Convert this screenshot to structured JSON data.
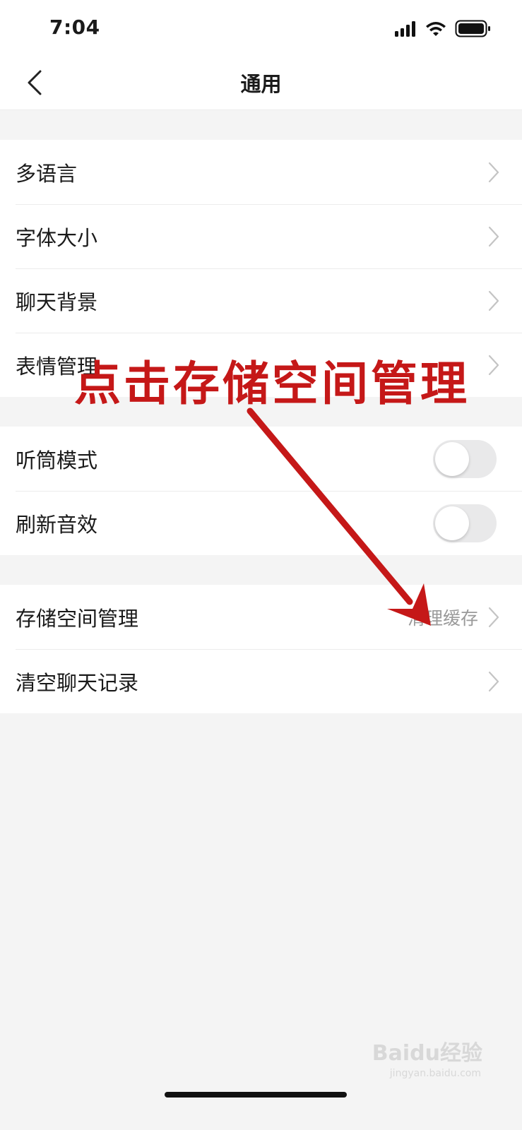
{
  "status_bar": {
    "time": "7:04"
  },
  "nav": {
    "title": "通用"
  },
  "groups": [
    {
      "items": [
        {
          "label": "多语言"
        },
        {
          "label": "字体大小"
        },
        {
          "label": "聊天背景"
        },
        {
          "label": "表情管理"
        }
      ]
    },
    {
      "items": [
        {
          "label": "听筒模式",
          "toggle": "off"
        },
        {
          "label": "刷新音效",
          "toggle": "off"
        }
      ]
    },
    {
      "items": [
        {
          "label": "存储空间管理",
          "value": "清理缓存"
        },
        {
          "label": "清空聊天记录"
        }
      ]
    }
  ],
  "annotation": {
    "text": "点击存储空间管理",
    "color": "#c51818"
  },
  "watermark": {
    "text": "Baidu经验",
    "sub": "jingyan.baidu.com"
  },
  "colors": {
    "background": "#f4f4f4",
    "card": "#ffffff",
    "accent": "#c51818"
  }
}
